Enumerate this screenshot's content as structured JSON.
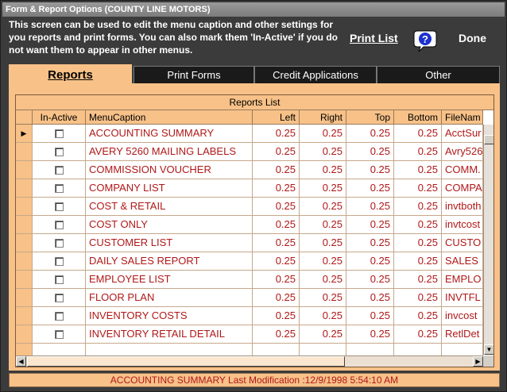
{
  "window": {
    "title": "Form & Report Options  (COUNTY LINE MOTORS)"
  },
  "info_text": "This screen can be used to edit the menu caption and other settings for you reports and print forms.  You can also mark them 'In-Active' if you do not want them to appear  in other menus.",
  "toolbar": {
    "print_list": "Print List",
    "help_icon": "question-mark-icon",
    "done": "Done"
  },
  "tabs": [
    {
      "label": "Reports",
      "active": true
    },
    {
      "label": "Print Forms",
      "active": false
    },
    {
      "label": "Credit Applications",
      "active": false
    },
    {
      "label": "Other",
      "active": false
    }
  ],
  "grid": {
    "caption": "Reports List",
    "columns": [
      "In-Active",
      "MenuCaption",
      "Left",
      "Right",
      "Top",
      "Bottom",
      "FileNam"
    ],
    "rows": [
      {
        "inactive": false,
        "caption": "ACCOUNTING SUMMARY",
        "left": "0.25",
        "right": "0.25",
        "top": "0.25",
        "bottom": "0.25",
        "file": "AcctSur"
      },
      {
        "inactive": false,
        "caption": "AVERY 5260 MAILING LABELS",
        "left": "0.25",
        "right": "0.25",
        "top": "0.25",
        "bottom": "0.25",
        "file": "Avry526"
      },
      {
        "inactive": false,
        "caption": "COMMISSION VOUCHER",
        "left": "0.25",
        "right": "0.25",
        "top": "0.25",
        "bottom": "0.25",
        "file": "COMM."
      },
      {
        "inactive": false,
        "caption": "COMPANY LIST",
        "left": "0.25",
        "right": "0.25",
        "top": "0.25",
        "bottom": "0.25",
        "file": "COMPA"
      },
      {
        "inactive": false,
        "caption": "COST & RETAIL",
        "left": "0.25",
        "right": "0.25",
        "top": "0.25",
        "bottom": "0.25",
        "file": "invtboth"
      },
      {
        "inactive": false,
        "caption": "COST ONLY",
        "left": "0.25",
        "right": "0.25",
        "top": "0.25",
        "bottom": "0.25",
        "file": "invtcost"
      },
      {
        "inactive": false,
        "caption": "CUSTOMER LIST",
        "left": "0.25",
        "right": "0.25",
        "top": "0.25",
        "bottom": "0.25",
        "file": "CUSTO"
      },
      {
        "inactive": false,
        "caption": "DAILY SALES REPORT",
        "left": "0.25",
        "right": "0.25",
        "top": "0.25",
        "bottom": "0.25",
        "file": "SALES"
      },
      {
        "inactive": false,
        "caption": "EMPLOYEE LIST",
        "left": "0.25",
        "right": "0.25",
        "top": "0.25",
        "bottom": "0.25",
        "file": "EMPLO"
      },
      {
        "inactive": false,
        "caption": "FLOOR PLAN",
        "left": "0.25",
        "right": "0.25",
        "top": "0.25",
        "bottom": "0.25",
        "file": "INVTFL"
      },
      {
        "inactive": false,
        "caption": "INVENTORY COSTS",
        "left": "0.25",
        "right": "0.25",
        "top": "0.25",
        "bottom": "0.25",
        "file": "invcost"
      },
      {
        "inactive": false,
        "caption": "INVENTORY RETAIL DETAIL",
        "left": "0.25",
        "right": "0.25",
        "top": "0.25",
        "bottom": "0.25",
        "file": "RetlDet"
      }
    ]
  },
  "status_text": "ACCOUNTING SUMMARY Last Modification :12/9/1998 5:54:10 AM"
}
